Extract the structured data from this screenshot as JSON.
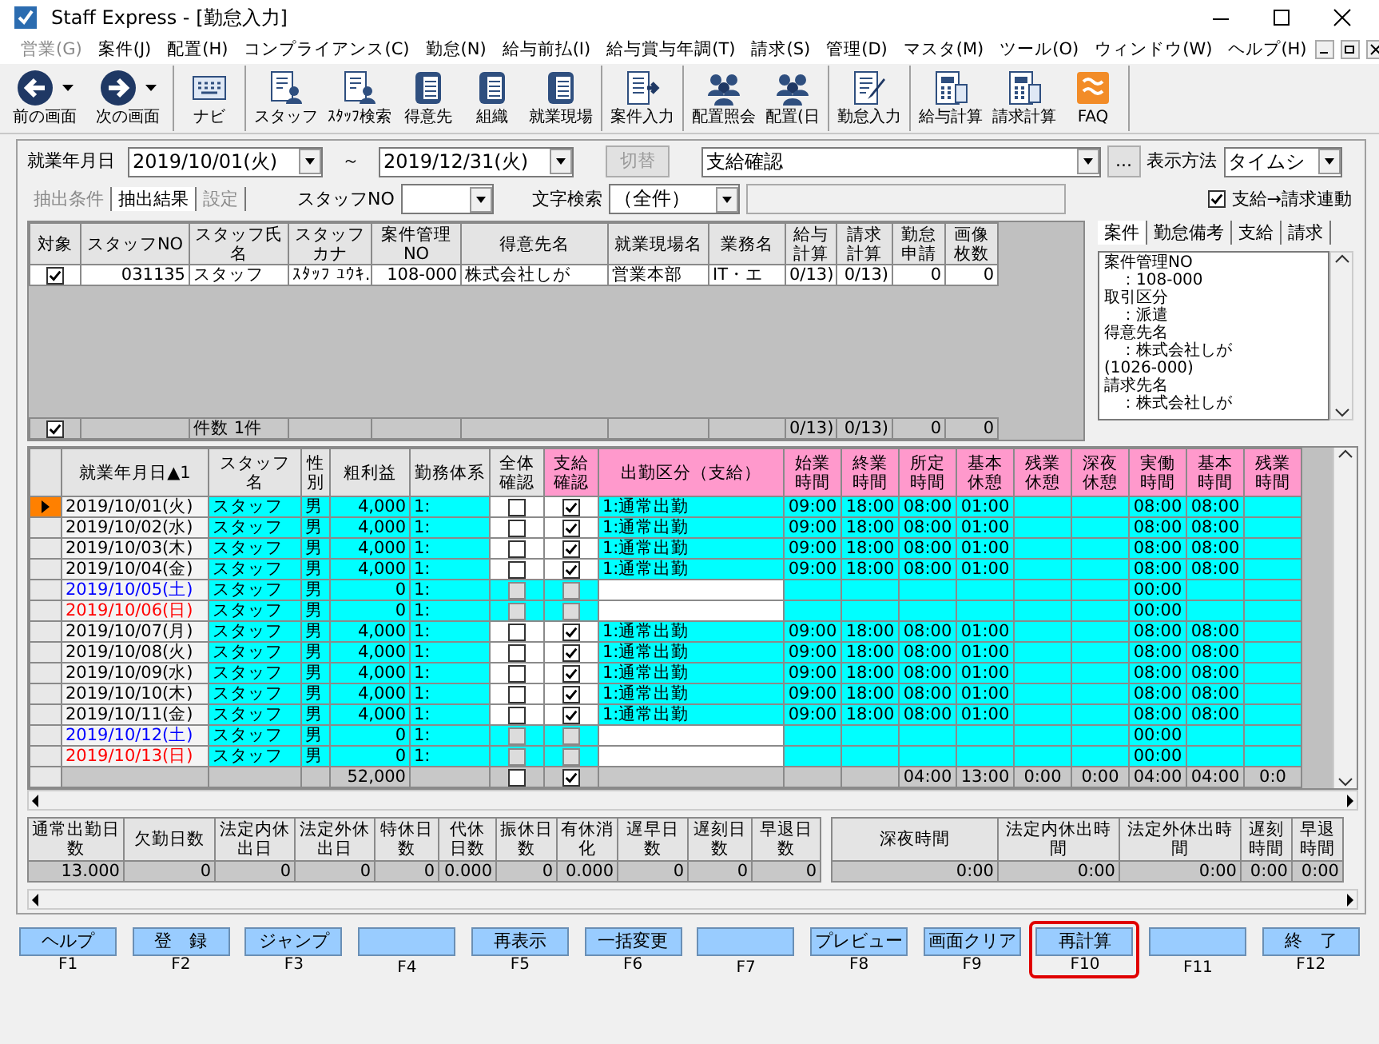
{
  "window": {
    "title": "Staff Express - [勤怠入力]"
  },
  "menu": [
    {
      "label": "営業(G)",
      "disabled": true
    },
    {
      "label": "案件(J)",
      "disabled": false
    },
    {
      "label": "配置(H)",
      "disabled": false
    },
    {
      "label": "コンプライアンス(C)",
      "disabled": false
    },
    {
      "label": "勤怠(N)",
      "disabled": false
    },
    {
      "label": "給与前払(I)",
      "disabled": false
    },
    {
      "label": "給与賞与年調(T)",
      "disabled": false
    },
    {
      "label": "請求(S)",
      "disabled": false
    },
    {
      "label": "管理(D)",
      "disabled": false
    },
    {
      "label": "マスタ(M)",
      "disabled": false
    },
    {
      "label": "ツール(O)",
      "disabled": false
    },
    {
      "label": "ウィンドウ(W)",
      "disabled": false
    },
    {
      "label": "ヘルプ(H)",
      "disabled": false
    }
  ],
  "toolbar_groups": [
    {
      "items": [
        {
          "label": "前の画面",
          "kind": "back",
          "dropdown": true
        },
        {
          "label": "次の画面",
          "kind": "forward",
          "dropdown": true
        }
      ]
    },
    {
      "items": [
        {
          "label": "ナビ",
          "kind": "navi",
          "dropdown": false
        }
      ]
    },
    {
      "items": [
        {
          "label": "スタッフ",
          "kind": "person",
          "dropdown": false
        },
        {
          "label": "ｽﾀｯﾌ検索",
          "kind": "person",
          "dropdown": false
        },
        {
          "label": "得意先",
          "kind": "binder",
          "dropdown": false
        },
        {
          "label": "組織",
          "kind": "binder",
          "dropdown": false
        },
        {
          "label": "就業現場",
          "kind": "binder",
          "dropdown": false
        }
      ]
    },
    {
      "items": [
        {
          "label": "案件入力",
          "kind": "entry",
          "dropdown": false
        }
      ]
    },
    {
      "items": [
        {
          "label": "配置照会",
          "kind": "group",
          "dropdown": false
        },
        {
          "label": "配置(日",
          "kind": "group",
          "dropdown": false
        }
      ]
    },
    {
      "items": [
        {
          "label": "勤怠入力",
          "kind": "edit",
          "dropdown": false
        }
      ]
    },
    {
      "items": [
        {
          "label": "給与計算",
          "kind": "calc",
          "dropdown": false
        },
        {
          "label": "請求計算",
          "kind": "calc",
          "dropdown": false
        },
        {
          "label": "FAQ",
          "kind": "help",
          "dropdown": false
        }
      ]
    }
  ],
  "filter": {
    "date_label": "就業年月日",
    "date_from": "2019/10/01(火)",
    "separator": "～",
    "date_to": "2019/12/31(火)",
    "switch_button": {
      "label": "切替",
      "disabled": true
    },
    "mode_select": "支給確認",
    "more_button": "...",
    "display_label": "表示方法",
    "display_select": "タイムシ",
    "tabs": [
      {
        "label": "抽出条件",
        "selected": false
      },
      {
        "label": "抽出結果",
        "selected": true
      },
      {
        "label": "設定",
        "selected": false
      }
    ],
    "staff_no_label": "スタッフNO",
    "text_search_label": "文字検索",
    "text_search_select": "（全件）",
    "link_checkbox": {
      "label": "支給→請求連動",
      "checked": true
    }
  },
  "upper_table": {
    "columns": [
      "対象",
      "スタッフNO",
      "スタッフ氏名",
      "スタッフカナ",
      "案件管理NO",
      "得意先名",
      "就業現場名",
      "業務名",
      "給与計算",
      "請求計算",
      "勤怠申請",
      "画像枚数"
    ],
    "rows": [
      {
        "cells": [
          {
            "checked": true
          },
          "031135",
          "スタッフ",
          "ｽﾀｯﾌ ﾕｳｷ.",
          "108-000",
          "株式会社しが",
          "営業本部",
          "IT・エ",
          "0/13)",
          "0/13)",
          "0",
          "0"
        ]
      }
    ],
    "footer": {
      "checked": true,
      "count": "件数 1件",
      "payroll": "0/13)",
      "billing": "0/13)",
      "requests": "0",
      "images": "0"
    }
  },
  "info_panel": {
    "tabs": [
      {
        "label": "案件",
        "selected": true
      },
      {
        "label": "勤怠備考",
        "selected": false
      },
      {
        "label": "支給",
        "selected": false
      },
      {
        "label": "請求",
        "selected": false
      }
    ],
    "lines": [
      "案件管理NO",
      "　：108-000",
      "取引区分",
      "　：派遣",
      "得意先名",
      "　：株式会社しが",
      "(1026-000)",
      "請求先名",
      "　：株式会社しが"
    ]
  },
  "main_grid": {
    "columns": [
      {
        "label": "就業年月日▲1",
        "highlight": false
      },
      {
        "label": "スタッフ名",
        "highlight": false
      },
      {
        "label": "性別",
        "highlight": false
      },
      {
        "label": "粗利益",
        "highlight": false
      },
      {
        "label": "勤務体系",
        "highlight": false
      },
      {
        "label": "全体確認",
        "highlight": false
      },
      {
        "label": "支給確認",
        "highlight": true
      },
      {
        "label": "出勤区分（支給）",
        "highlight": true
      },
      {
        "label": "始業時間",
        "highlight": true
      },
      {
        "label": "終業時間",
        "highlight": true
      },
      {
        "label": "所定時間",
        "highlight": true
      },
      {
        "label": "基本休憩",
        "highlight": true
      },
      {
        "label": "残業休憩",
        "highlight": true
      },
      {
        "label": "深夜休憩",
        "highlight": true
      },
      {
        "label": "実働時間",
        "highlight": true
      },
      {
        "label": "基本時間",
        "highlight": true
      },
      {
        "label": "残業時間",
        "highlight": true
      }
    ],
    "rows": [
      {
        "selected": true,
        "kind": "workday",
        "color": "#000000",
        "date": "2019/10/01(火)",
        "staff": "スタッフ",
        "gender": "男",
        "profit": "4,000",
        "system": "1:",
        "all_check": false,
        "pay_check": true,
        "attendance": "1:通常出勤",
        "times": {
          "start": "09:00",
          "end": "18:00",
          "scheduled": "08:00",
          "basic_break": "01:00",
          "actual": "08:00",
          "basic_time": "08:00"
        }
      },
      {
        "selected": false,
        "kind": "workday",
        "color": "#000000",
        "date": "2019/10/02(水)",
        "staff": "スタッフ",
        "gender": "男",
        "profit": "4,000",
        "system": "1:",
        "all_check": false,
        "pay_check": true,
        "attendance": "1:通常出勤",
        "times": {
          "start": "09:00",
          "end": "18:00",
          "scheduled": "08:00",
          "basic_break": "01:00",
          "actual": "08:00",
          "basic_time": "08:00"
        }
      },
      {
        "selected": false,
        "kind": "workday",
        "color": "#000000",
        "date": "2019/10/03(木)",
        "staff": "スタッフ",
        "gender": "男",
        "profit": "4,000",
        "system": "1:",
        "all_check": false,
        "pay_check": true,
        "attendance": "1:通常出勤",
        "times": {
          "start": "09:00",
          "end": "18:00",
          "scheduled": "08:00",
          "basic_break": "01:00",
          "actual": "08:00",
          "basic_time": "08:00"
        }
      },
      {
        "selected": false,
        "kind": "workday",
        "color": "#000000",
        "date": "2019/10/04(金)",
        "staff": "スタッフ",
        "gender": "男",
        "profit": "4,000",
        "system": "1:",
        "all_check": false,
        "pay_check": true,
        "attendance": "1:通常出勤",
        "times": {
          "start": "09:00",
          "end": "18:00",
          "scheduled": "08:00",
          "basic_break": "01:00",
          "actual": "08:00",
          "basic_time": "08:00"
        }
      },
      {
        "selected": false,
        "kind": "holiday",
        "color": "#0000ff",
        "date": "2019/10/05(土)",
        "staff": "スタッフ",
        "gender": "男",
        "profit": "0",
        "system": "1:",
        "all_check": false,
        "pay_check": false,
        "times": {
          "actual": "00:00"
        }
      },
      {
        "selected": false,
        "kind": "holiday",
        "color": "#ff0000",
        "date": "2019/10/06(日)",
        "staff": "スタッフ",
        "gender": "男",
        "profit": "0",
        "system": "1:",
        "all_check": false,
        "pay_check": false,
        "times": {
          "actual": "00:00"
        }
      },
      {
        "selected": false,
        "kind": "workday",
        "color": "#000000",
        "date": "2019/10/07(月)",
        "staff": "スタッフ",
        "gender": "男",
        "profit": "4,000",
        "system": "1:",
        "all_check": false,
        "pay_check": true,
        "attendance": "1:通常出勤",
        "times": {
          "start": "09:00",
          "end": "18:00",
          "scheduled": "08:00",
          "basic_break": "01:00",
          "actual": "08:00",
          "basic_time": "08:00"
        }
      },
      {
        "selected": false,
        "kind": "workday",
        "color": "#000000",
        "date": "2019/10/08(火)",
        "staff": "スタッフ",
        "gender": "男",
        "profit": "4,000",
        "system": "1:",
        "all_check": false,
        "pay_check": true,
        "attendance": "1:通常出勤",
        "times": {
          "start": "09:00",
          "end": "18:00",
          "scheduled": "08:00",
          "basic_break": "01:00",
          "actual": "08:00",
          "basic_time": "08:00"
        }
      },
      {
        "selected": false,
        "kind": "workday",
        "color": "#000000",
        "date": "2019/10/09(水)",
        "staff": "スタッフ",
        "gender": "男",
        "profit": "4,000",
        "system": "1:",
        "all_check": false,
        "pay_check": true,
        "attendance": "1:通常出勤",
        "times": {
          "start": "09:00",
          "end": "18:00",
          "scheduled": "08:00",
          "basic_break": "01:00",
          "actual": "08:00",
          "basic_time": "08:00"
        }
      },
      {
        "selected": false,
        "kind": "workday",
        "color": "#000000",
        "date": "2019/10/10(木)",
        "staff": "スタッフ",
        "gender": "男",
        "profit": "4,000",
        "system": "1:",
        "all_check": false,
        "pay_check": true,
        "attendance": "1:通常出勤",
        "times": {
          "start": "09:00",
          "end": "18:00",
          "scheduled": "08:00",
          "basic_break": "01:00",
          "actual": "08:00",
          "basic_time": "08:00"
        }
      },
      {
        "selected": false,
        "kind": "workday",
        "color": "#000000",
        "date": "2019/10/11(金)",
        "staff": "スタッフ",
        "gender": "男",
        "profit": "4,000",
        "system": "1:",
        "all_check": false,
        "pay_check": true,
        "attendance": "1:通常出勤",
        "times": {
          "start": "09:00",
          "end": "18:00",
          "scheduled": "08:00",
          "basic_break": "01:00",
          "actual": "08:00",
          "basic_time": "08:00"
        }
      },
      {
        "selected": false,
        "kind": "holiday",
        "color": "#0000ff",
        "date": "2019/10/12(土)",
        "staff": "スタッフ",
        "gender": "男",
        "profit": "0",
        "system": "1:",
        "all_check": false,
        "pay_check": false,
        "times": {
          "actual": "00:00"
        }
      },
      {
        "selected": false,
        "kind": "holiday",
        "color": "#ff0000",
        "date": "2019/10/13(日)",
        "staff": "スタッフ",
        "gender": "男",
        "profit": "0",
        "system": "1:",
        "all_check": false,
        "pay_check": false,
        "times": {
          "actual": "00:00"
        }
      }
    ],
    "footer": {
      "profit": "52,000",
      "all_check": false,
      "pay_check": true,
      "totals": {
        "scheduled": "04:00",
        "basic_break": "13:00",
        "overtime_break": "0:00",
        "night_break": "0:00",
        "actual": "04:00",
        "basic_time": "04:00",
        "overtime": "0:0"
      }
    }
  },
  "summary": {
    "left": {
      "columns": [
        "通常出勤日数",
        "欠勤日数",
        "法定内休出日",
        "法定外休出日",
        "特休日数",
        "代休日数",
        "振休日数",
        "有休消化",
        "遅早日数",
        "遅刻日数",
        "早退日数"
      ],
      "values": [
        "13.000",
        "0",
        "0",
        "0",
        "0",
        "0.000",
        "0",
        "0.000",
        "0",
        "0",
        "0"
      ]
    },
    "right": {
      "columns": [
        "深夜時間",
        "法定内休出時間",
        "法定外休出時間",
        "遅刻時間",
        "早退時間"
      ],
      "values": [
        "0:00",
        "0:00",
        "0:00",
        "0:00",
        "0:00"
      ]
    }
  },
  "function_keys": [
    {
      "label": "ヘルプ",
      "key": "F1",
      "highlighted": false
    },
    {
      "label": "登　録",
      "key": "F2",
      "highlighted": false
    },
    {
      "label": "ジャンプ",
      "key": "F3",
      "highlighted": false
    },
    {
      "key": "F4",
      "highlighted": false
    },
    {
      "label": "再表示",
      "key": "F5",
      "highlighted": false
    },
    {
      "label": "一括変更",
      "key": "F6",
      "highlighted": false
    },
    {
      "key": "F7",
      "highlighted": false
    },
    {
      "label": "プレビュー",
      "key": "F8",
      "highlighted": false
    },
    {
      "label": "画面クリア",
      "key": "F9",
      "highlighted": false
    },
    {
      "label": "再計算",
      "key": "F10",
      "highlighted": true
    },
    {
      "key": "F11",
      "highlighted": false
    },
    {
      "label": "終　了",
      "key": "F12",
      "highlighted": false
    }
  ]
}
